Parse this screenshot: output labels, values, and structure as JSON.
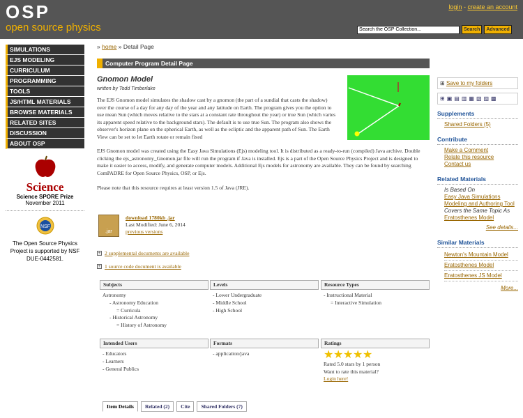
{
  "header": {
    "logo": "OSP",
    "tagline": "open source physics",
    "login": "login",
    "create_account": "create an account",
    "search_value": "Search the OSP Collection...",
    "search_btn": "Search",
    "advanced_btn": "Advanced"
  },
  "nav": [
    "SIMULATIONS",
    "EJS MODELING",
    "CURRICULUM",
    "PROGRAMMING",
    "TOOLS",
    "JS/HTML MATERIALS",
    "BROWSE MATERIALS",
    "RELATED SITES",
    "DISCUSSION",
    "ABOUT OSP"
  ],
  "spore": {
    "logo_text": "Science",
    "title": "Science SPORE Prize",
    "date": "November 2011"
  },
  "nsf": {
    "logo": "NSF",
    "text": "The Open Source Physics Project is supported by NSF DUE-0442581."
  },
  "breadcrumb": {
    "home": "home",
    "sep": "»",
    "current": "Detail Page"
  },
  "page_bar": "Computer Program Detail Page",
  "resource": {
    "title": "Gnomon Model",
    "author": "written by Todd Timberlake",
    "desc1": "The EJS Gnomon model simulates the shadow cast by a gnomon (the part of a sundial that casts the shadow) over the course of a day for any day of the year and any latitude on Earth. The program gives you the option to use mean Sun (which moves relative to the stars at a constant rate throughout the year) or true Sun (which varies its apparent speed relative to the background stars). The default is to use true Sun. The program also shows the observer's horizon plane on the spherical Earth, as well as the ecliptic and the apparent path of Sun. The Earth View can be set to let Earth rotate or remain fixed",
    "desc2": "EJS Gnomon model was created using the Easy Java Simulations (Ejs) modeling tool. It is distributed as a ready-to-run (compiled) Java archive. Double clicking the ejs_astronomy_Gnomon.jar file will run the program if Java is installed. Ejs is a part of the Open Source Physics Project and is designed to make it easier to access, modify, and generate computer models. Additional Ejs models for astronomy are available. They can be found by searching ComPADRE for Open Source Physics, OSP, or Ejs.",
    "note": "Please note that this resource requires at least version 1.5 of Java (JRE).",
    "jar_label": ".jar",
    "download": "download 1780kb .jar",
    "modified": "Last Modified: June 6, 2014",
    "previous": "previous versions",
    "supplemental": "2 supplemental documents are available",
    "source": "1 source code document is available"
  },
  "meta": {
    "subjects_h": "Subjects",
    "levels_h": "Levels",
    "types_h": "Resource Types",
    "subjects": [
      "Astronomy",
      "- Astronomy Education",
      "= Curricula",
      "- Historical Astronomy",
      "= History of Astronomy"
    ],
    "levels": [
      "- Lower Undergraduate",
      "- Middle School",
      "- High School"
    ],
    "types": [
      "- Instructional Material",
      "= Interactive Simulation"
    ],
    "users_h": "Intended Users",
    "formats_h": "Formats",
    "ratings_h": "Ratings",
    "users": [
      "- Educators",
      "- Learners",
      "- General Publics"
    ],
    "formats": [
      "- application/java"
    ],
    "rating_text": "Rated 5.0 stars by 1 person",
    "rate_q": "Want to rate this material?",
    "login": "Login here!"
  },
  "tabs": [
    "Item Details",
    "Related (2)",
    "Cite",
    "Shared Folders (7)"
  ],
  "right": {
    "save": "Save to my folders",
    "supplements_h": "Supplements",
    "shared_folders": "Shared Folders (5)",
    "contribute_h": "Contribute",
    "comment": "Make a Comment",
    "relate": "Relate this resource",
    "contact": "Contact us",
    "related_h": "Related Materials",
    "based_on": "Is Based On",
    "based_link": "Easy Java Simulations Modeling and Authoring Tool",
    "covers": "Covers the Same Topic As",
    "covers_link": "Eratosthenes Model",
    "see_details": "See details...",
    "similar_h": "Similar Materials",
    "similar": [
      "Newton's Mountain Model",
      "Eratosthenes Model",
      "Eratosthenes JS Model"
    ],
    "more": "More..."
  }
}
